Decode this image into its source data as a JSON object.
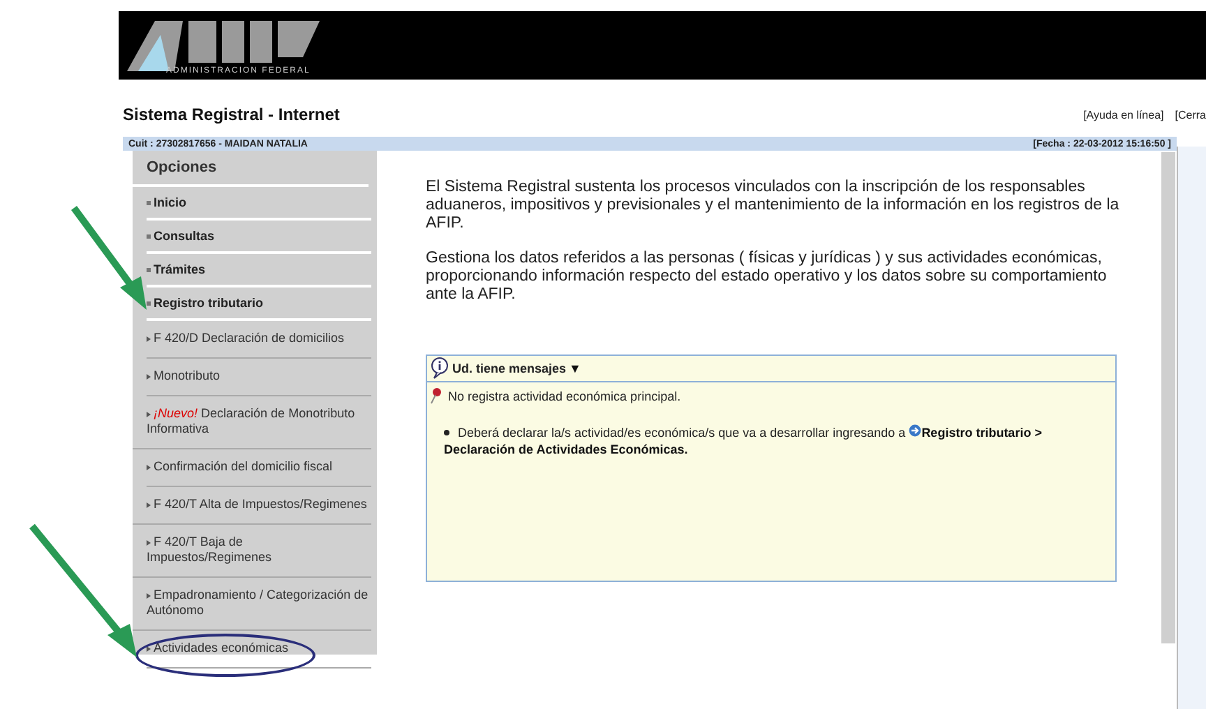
{
  "header": {
    "caption": "ADMINISTRACION FEDERAL"
  },
  "title": "Sistema Registral - Internet",
  "top_links": [
    "[Ayuda en línea]",
    "[Cerra"
  ],
  "user_bar": {
    "user": "Cuit : 27302817656 - MAIDAN NATALIA",
    "date": "[Fecha : 22-03-2012 15:16:50 ]"
  },
  "sidebar": {
    "heading": "Opciones",
    "items": [
      {
        "kind": "section",
        "label": "Inicio"
      },
      {
        "kind": "section",
        "label": "Consultas"
      },
      {
        "kind": "section",
        "label": "Trámites"
      },
      {
        "kind": "section",
        "label": "Registro tributario"
      },
      {
        "kind": "sub",
        "label": "F 420/D Declaración de domicilios"
      },
      {
        "kind": "sub",
        "label": "Monotributo"
      },
      {
        "kind": "sub",
        "badge": "¡Nuevo!",
        "label": "Declaración de Monotributo Informativa"
      },
      {
        "kind": "sub",
        "label": "Confirmación del domicilio fiscal"
      },
      {
        "kind": "sub",
        "label": "F 420/T Alta de Impuestos/Regimenes"
      },
      {
        "kind": "sub",
        "label": "F 420/T Baja de Impuestos/Regimenes"
      },
      {
        "kind": "sub",
        "label": "Empadronamiento / Categorización de Autónomo"
      },
      {
        "kind": "sub",
        "label": "Actividades económicas",
        "circled": true
      }
    ]
  },
  "content": {
    "paragraphs": [
      "El Sistema Registral sustenta los procesos vinculados con la inscripción de los responsables aduaneros, impositivos y previsionales y el mantenimiento de la información en los registros de la AFIP.",
      "Gestiona los datos referidos a las personas ( físicas y jurídicas ) y sus actividades económicas, proporcionando información respecto del estado operativo y los datos sobre su comportamiento ante la AFIP."
    ],
    "messages": {
      "title": "Ud. tiene mensajes",
      "toggle": "▼",
      "alert": "No registra actividad económica principal.",
      "note": {
        "text": "Deberá declarar la/s actividad/es económica/s que va a desarrollar ingresando a",
        "link_parts": [
          "Registro tributario >",
          "Declaración de Actividades Económicas."
        ]
      }
    }
  }
}
